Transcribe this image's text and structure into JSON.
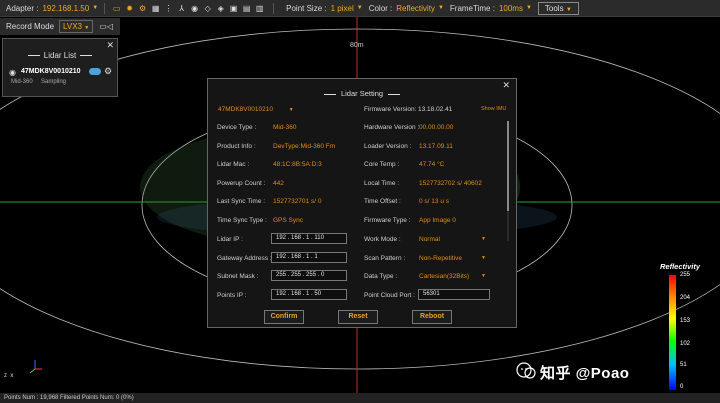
{
  "toolbar": {
    "adapter_label": "Adapter :",
    "adapter_value": "192.168.1.50",
    "point_size_label": "Point Size :",
    "point_size_value": "1 pixel",
    "color_label": "Color :",
    "color_value": "Reflectivity",
    "frame_time_label": "FrameTime :",
    "frame_time_value": "100ms",
    "tools_label": "Tools"
  },
  "record": {
    "label": "Record Mode",
    "value": "LVX3"
  },
  "lidar_list": {
    "title": "Lidar List",
    "item": {
      "code": "47MDK8V0010210",
      "model": "Mid-360",
      "status": "Sampling"
    }
  },
  "view": {
    "range_label": "80m"
  },
  "dialog": {
    "title": "Lidar Setting",
    "device_select": "47MDK8V0010210",
    "firmware_label": "Firmware Version:",
    "firmware_value": "13.18.02.41",
    "show_imu": "Show IMU",
    "left": {
      "device_type_label": "Device Type :",
      "device_type_value": "Mid-360",
      "product_info_label": "Product Info :",
      "product_info_value": "DevType:Mid-360 Fm",
      "lidar_mac_label": "Lidar Mac :",
      "lidar_mac_value": "48:1C:8B:5A:D:3",
      "powerup_label": "Powerup Count :",
      "powerup_value": "442",
      "last_sync_label": "Last Sync Time :",
      "last_sync_value": "1527732701 s/ 0",
      "time_sync_label": "Time Sync Type :",
      "time_sync_value": "GPS Sync",
      "lidar_ip_label": "Lidar IP :",
      "lidar_ip_value": "192 . 168 .  1  . 110",
      "gateway_label": "Gateway Address :",
      "gateway_value": "192 . 168 .  1  .  1",
      "subnet_label": "Subnet Mask :",
      "subnet_value": "255 . 255 . 255 .  0",
      "points_ip_label": "Points IP :",
      "points_ip_value": "192 . 168 .  1  .  50"
    },
    "right": {
      "hw_label": "Hardware Version :",
      "hw_value": "00.00.00.00",
      "loader_label": "Loader Version :",
      "loader_value": "13.17.09.11",
      "core_temp_label": "Core Temp :",
      "core_temp_value": "47.74 °C",
      "local_time_label": "Local Time :",
      "local_time_value": "1527732702 s/ 40602",
      "time_offset_label": "Time Offset :",
      "time_offset_value": "0 s/ 13 u s",
      "fw_type_label": "Firmware Type :",
      "fw_type_value": "App Image 0",
      "work_mode_label": "Work Mode :",
      "work_mode_value": "Normal",
      "scan_label": "Scan Pattern :",
      "scan_value": "Non-Repetitive",
      "data_type_label": "Data Type :",
      "data_type_value": "Cartesian(32Bits)",
      "pc_port_label": "Point Cloud Port :",
      "pc_port_value": "56301"
    },
    "buttons": {
      "confirm": "Confirm",
      "reset": "Reset",
      "reboot": "Reboot"
    }
  },
  "legend": {
    "title": "Reflectivity",
    "ticks": [
      "255",
      "204",
      "153",
      "102",
      "51",
      "0"
    ]
  },
  "status": {
    "text": "Points Num : 19,968  Filtered Points Num: 0 (0%)"
  },
  "watermark": {
    "text": "知乎 @Poao"
  },
  "colors": {
    "accent": "#f2a823",
    "panel": "#2b2b2b",
    "dialog_bg": "#151515"
  }
}
